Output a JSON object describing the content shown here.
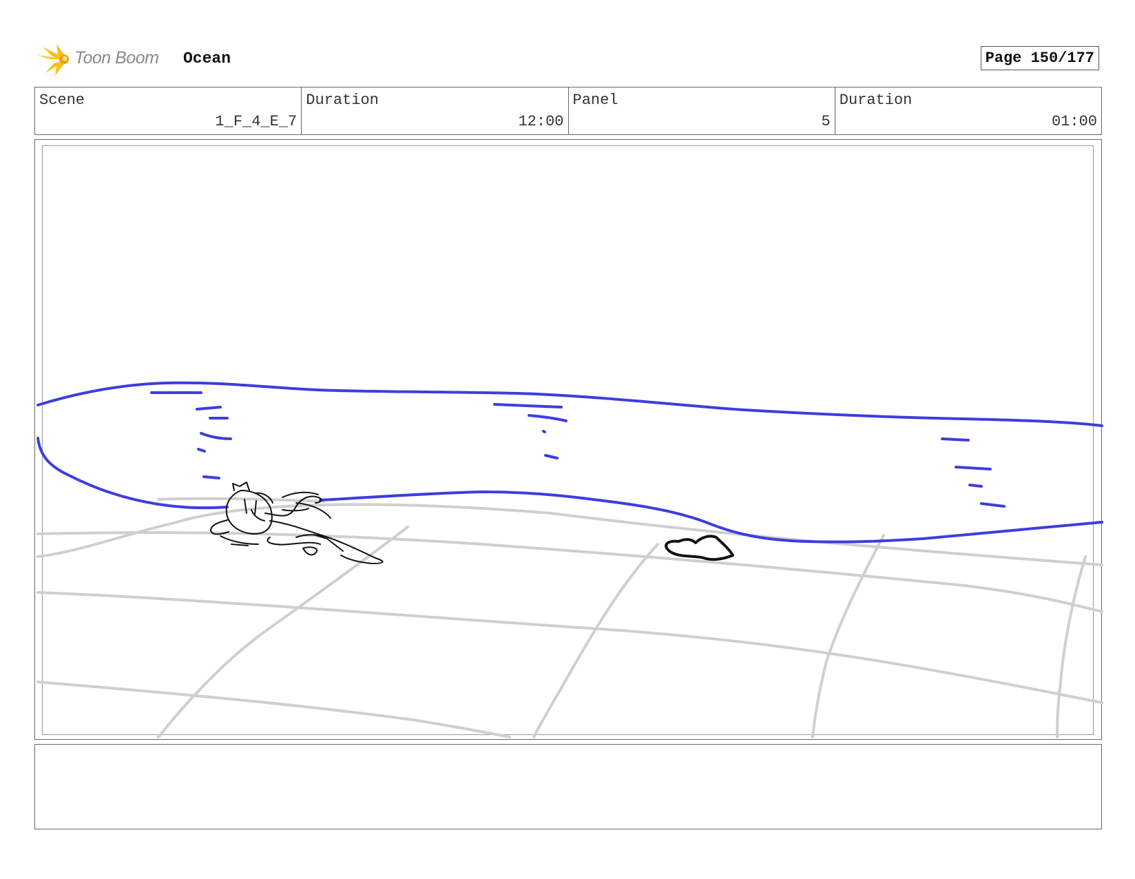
{
  "header": {
    "brand": "Toon Boom",
    "project": "Ocean",
    "page_label": "Page 150/177"
  },
  "info": {
    "scene_label": "Scene",
    "scene_value": "1_F_4_E_7",
    "scene_duration_label": "Duration",
    "scene_duration_value": "12:00",
    "panel_label": "Panel",
    "panel_value": "5",
    "panel_duration_label": "Duration",
    "panel_duration_value": "01:00"
  },
  "notes": {
    "text": ""
  },
  "colors": {
    "water_line": "#3d3ddf",
    "grid_line": "#cfcfcf",
    "sketch_line": "#111111",
    "logo_yellow": "#f7c31b"
  },
  "icons": {
    "logo": "toon-boom-starburst-icon"
  }
}
